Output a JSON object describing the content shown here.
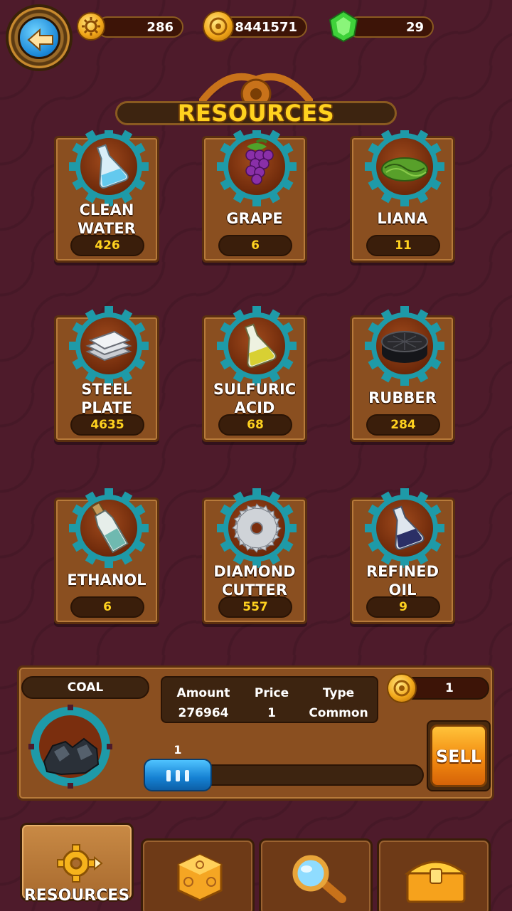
{
  "top_bar": {
    "gears": "286",
    "coins": "8441571",
    "gems": "29"
  },
  "title": "RESOURCES",
  "resources": [
    {
      "label": "CLEAN\nWATER",
      "qty": "426",
      "icon": "flask-water-icon",
      "color": "#63c9ee"
    },
    {
      "label": "GRAPE",
      "qty": "6",
      "icon": "grape-icon",
      "color": "#8a2fa8"
    },
    {
      "label": "LIANA",
      "qty": "11",
      "icon": "liana-icon",
      "color": "#58a02a"
    },
    {
      "label": "STEEL\nPLATE",
      "qty": "4635",
      "icon": "steel-plate-icon",
      "color": "#c9ccd2"
    },
    {
      "label": "SULFURIC\nACID",
      "qty": "68",
      "icon": "flask-acid-icon",
      "color": "#d8d033"
    },
    {
      "label": "RUBBER",
      "qty": "284",
      "icon": "rubber-icon",
      "color": "#2a2a2e"
    },
    {
      "label": "ETHANOL",
      "qty": "6",
      "icon": "bottle-icon",
      "color": "#6fb9b0"
    },
    {
      "label": "DIAMOND\nCUTTER",
      "qty": "557",
      "icon": "saw-blade-icon",
      "color": "#cfd3d8"
    },
    {
      "label": "REFINED\nOIL",
      "qty": "9",
      "icon": "flask-oil-icon",
      "color": "#2b2f66"
    }
  ],
  "selected": {
    "name": "COAL",
    "icon": "coal-icon",
    "amount_label": "Amount",
    "amount": "276964",
    "price_label": "Price",
    "price": "1",
    "type_label": "Type",
    "type": "Common",
    "unit_price": "1",
    "quantity": "1",
    "sell_label": "SELL"
  },
  "tabs": [
    {
      "label": "RESOURCES",
      "icon": "gear-icon",
      "active": true
    },
    {
      "label": "",
      "icon": "dice-icon",
      "active": false
    },
    {
      "label": "",
      "icon": "magnifier-icon",
      "active": false
    },
    {
      "label": "",
      "icon": "chest-icon",
      "active": false
    }
  ],
  "colors": {
    "accent_yellow": "#ffd21f",
    "teal_ring": "#1e9aa8",
    "card_brown": "#8a4f20",
    "background": "#4e1b2b"
  }
}
